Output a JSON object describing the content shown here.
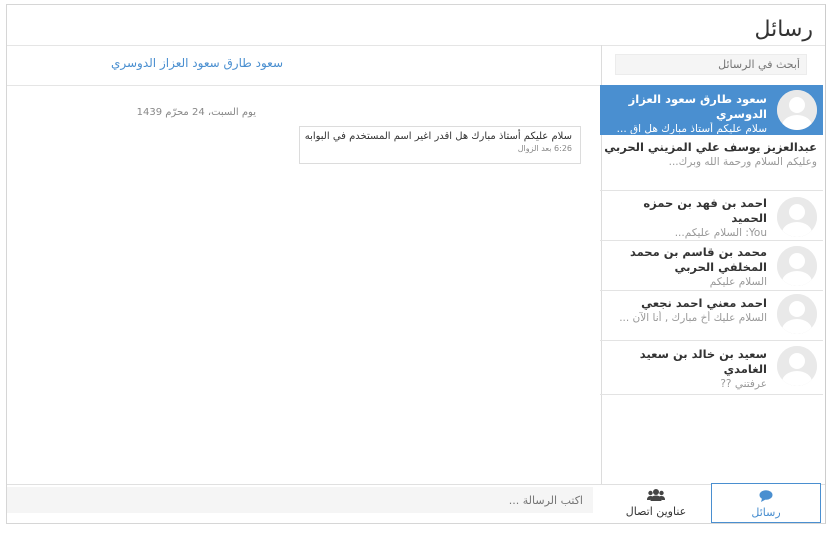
{
  "page": {
    "title": "رسائل"
  },
  "search": {
    "placeholder": "أبحث في الرسائل"
  },
  "conversation": {
    "name": "سعود طارق سعود العزاز الدوسري",
    "date": "يوم السبت، 24 محرّم 1439",
    "messages": [
      {
        "text": "سلام عليكم أستاذ مبارك هل اقدر اغير اسم المستخدم في البوابه",
        "time": "6:26 بعد الزوال"
      }
    ]
  },
  "conversations": [
    {
      "name": "سعود طارق سعود العزاز الدوسري",
      "preview": "سلام عليكم أستاذ مبارك هل اق ...",
      "active": true,
      "has_avatar": true
    },
    {
      "name": "عبدالعزيز يوسف علي المزيني الحربي",
      "preview": "وعليكم السلام ورحمة الله وبرك...",
      "active": false,
      "has_avatar": false
    },
    {
      "name": "احمد بن فهد بن حمزه الحميد",
      "preview": "You: السلام عليكم...",
      "active": false,
      "has_avatar": true
    },
    {
      "name": "محمد بن قاسم بن محمد المخلفي الحربي",
      "preview": "السلام عليكم",
      "active": false,
      "has_avatar": true
    },
    {
      "name": "احمد معني احمد نجعي",
      "preview": "السلام عليك أخ مبارك , أنا الآن ...",
      "active": false,
      "has_avatar": true
    },
    {
      "name": "سعيد بن خالد بن سعيد الغامدي",
      "preview": "عرفتني ??",
      "active": false,
      "has_avatar": true
    }
  ],
  "compose": {
    "placeholder": "اكتب الرسالة ..."
  },
  "tabs": {
    "messages": {
      "label": "رسائل",
      "icon": "comment-icon"
    },
    "contacts": {
      "label": "عناوين اتصال",
      "icon": "users-icon"
    }
  },
  "colors": {
    "accent": "#4a8fd0",
    "muted": "#999999"
  }
}
